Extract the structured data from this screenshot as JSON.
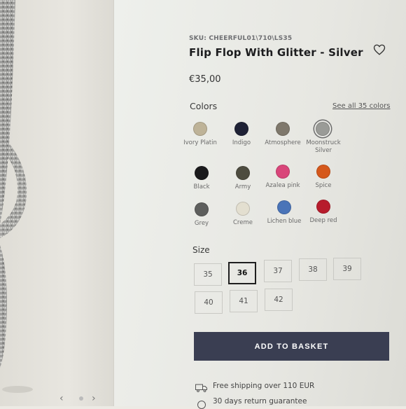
{
  "product": {
    "sku": "SKU: CHEERFUL01\\710\\LS35",
    "title": "Flip Flop With Glitter - Silver",
    "price": "€35,00"
  },
  "colors": {
    "label": "Colors",
    "see_all": "See all 35 colors",
    "selected": "Moonstruck Silver",
    "items": [
      {
        "name": "Ivory Platin",
        "hex": "#beb398"
      },
      {
        "name": "Indigo",
        "hex": "#1f2236"
      },
      {
        "name": "Atmosphere",
        "hex": "#7f786c"
      },
      {
        "name": "Moonstruck Silver",
        "hex": "#9a9b97"
      },
      {
        "name": "Black",
        "hex": "#1a1a1c"
      },
      {
        "name": "Army",
        "hex": "#4d4c3f"
      },
      {
        "name": "Azalea pink",
        "hex": "#d9467a"
      },
      {
        "name": "Spice",
        "hex": "#d5581b"
      },
      {
        "name": "Grey",
        "hex": "#5e5f5d"
      },
      {
        "name": "Creme",
        "hex": "#e3dfd0"
      },
      {
        "name": "Lichen blue",
        "hex": "#4a74b8"
      },
      {
        "name": "Deep red",
        "hex": "#b71c2c"
      }
    ]
  },
  "size": {
    "label": "Size",
    "selected": "36",
    "options": [
      "35",
      "36",
      "37",
      "38",
      "39",
      "40",
      "41",
      "42"
    ]
  },
  "cta": {
    "add_to_basket": "ADD TO BASKET"
  },
  "info": {
    "shipping": "Free shipping over 110 EUR",
    "returns": "30 days return guarantee"
  },
  "gallery": {
    "prev": "‹",
    "next": "›"
  }
}
